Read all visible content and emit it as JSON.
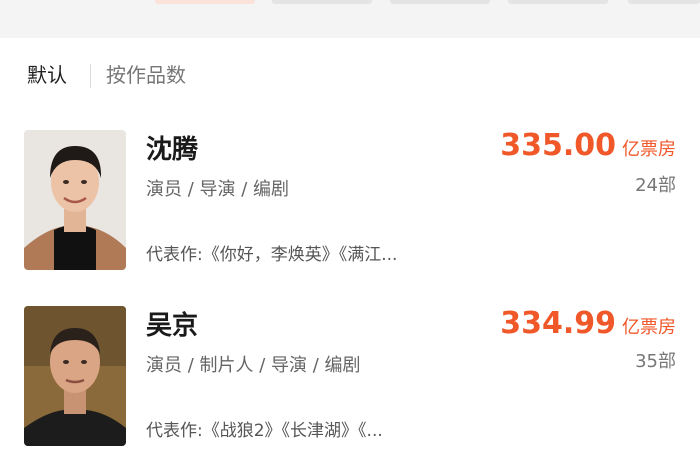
{
  "sort_bar": {
    "options": [
      {
        "label": "默认",
        "active": true
      },
      {
        "label": "按作品数",
        "active": false
      }
    ]
  },
  "people": [
    {
      "name": "沈腾",
      "roles": "演员 / 导演 / 编剧",
      "works": "代表作:《你好，李焕英》《满江...",
      "box_office": "335.00",
      "box_office_unit": "亿票房",
      "work_count": "24部"
    },
    {
      "name": "吴京",
      "roles": "演员 / 制片人 / 导演 / 编剧",
      "works": "代表作:《战狼2》《长津湖》《...",
      "box_office": "334.99",
      "box_office_unit": "亿票房",
      "work_count": "35部"
    }
  ],
  "colors": {
    "accent": "#f0582a",
    "text_primary": "#1a1a1a",
    "text_secondary": "#666666"
  }
}
